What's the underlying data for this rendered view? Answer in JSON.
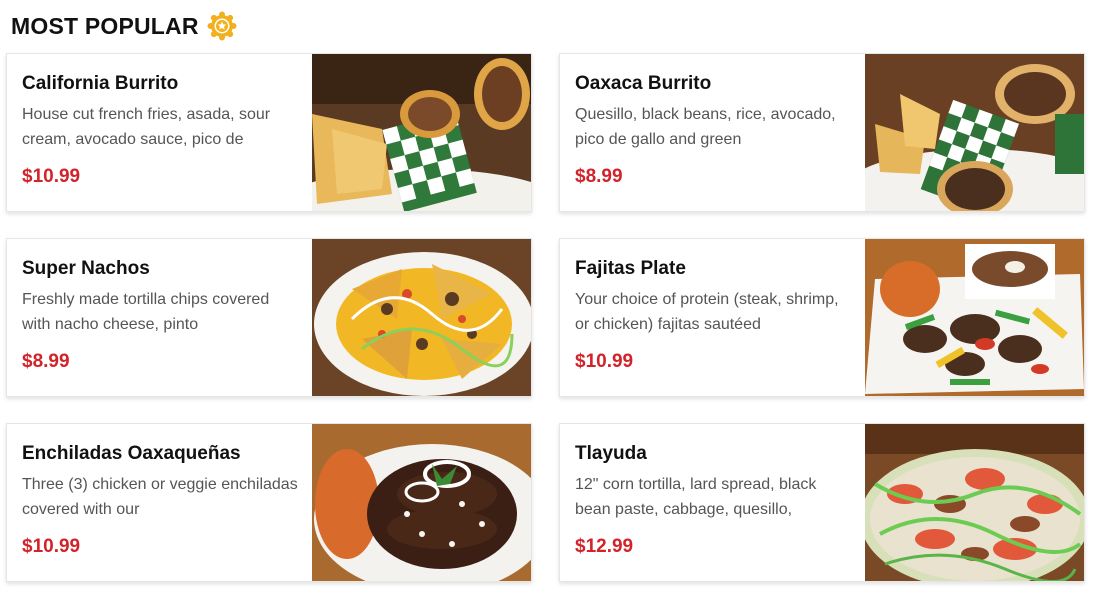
{
  "header": {
    "title": "MOST POPULAR",
    "icon": "star-badge-icon",
    "icon_color": "#f2b01e"
  },
  "colors": {
    "price": "#d2232a",
    "text": "#111111",
    "desc": "#555555"
  },
  "items": [
    {
      "name": "California Burrito",
      "description": "House cut french fries, asada, sour cream, avocado sauce, pico de",
      "price": "$10.99",
      "image": "california-burrito-photo"
    },
    {
      "name": "Oaxaca Burrito",
      "description": "Quesillo, black beans, rice, avocado, pico de gallo and green",
      "price": "$8.99",
      "image": "oaxaca-burrito-photo"
    },
    {
      "name": "Super Nachos",
      "description": "Freshly made tortilla chips covered with nacho cheese, pinto",
      "price": "$8.99",
      "image": "super-nachos-photo"
    },
    {
      "name": "Fajitas Plate",
      "description": "Your choice of protein (steak, shrimp, or chicken) fajitas sautéed",
      "price": "$10.99",
      "image": "fajitas-plate-photo"
    },
    {
      "name": "Enchiladas Oaxaqueñas",
      "description": "Three (3) chicken or veggie enchiladas covered with our",
      "price": "$10.99",
      "image": "enchiladas-photo"
    },
    {
      "name": "Tlayuda",
      "description": "12\" corn tortilla, lard spread, black bean paste, cabbage, quesillo,",
      "price": "$12.99",
      "image": "tlayuda-photo"
    }
  ]
}
